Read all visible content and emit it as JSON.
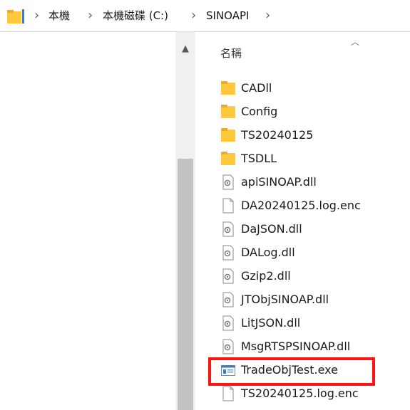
{
  "breadcrumb": {
    "items": [
      "本機",
      "本機磁碟 (C:)",
      "SINOAPI"
    ],
    "separator": "›"
  },
  "list": {
    "column_header": "名稱",
    "files": [
      {
        "name": "CADll",
        "icon": "folder-icon"
      },
      {
        "name": "Config",
        "icon": "folder-icon"
      },
      {
        "name": "TS20240125",
        "icon": "folder-icon"
      },
      {
        "name": "TSDLL",
        "icon": "folder-icon"
      },
      {
        "name": "apiSINOAP.dll",
        "icon": "dll-icon"
      },
      {
        "name": "DA20240125.log.enc",
        "icon": "file-icon"
      },
      {
        "name": "DaJSON.dll",
        "icon": "dll-icon"
      },
      {
        "name": "DALog.dll",
        "icon": "dll-icon"
      },
      {
        "name": "Gzip2.dll",
        "icon": "dll-icon"
      },
      {
        "name": "JTObjSINOAP.dll",
        "icon": "dll-icon"
      },
      {
        "name": "LitJSON.dll",
        "icon": "dll-icon"
      },
      {
        "name": "MsgRTSPSINOAP.dll",
        "icon": "dll-icon"
      },
      {
        "name": "TradeObjTest.exe",
        "icon": "exe-icon"
      },
      {
        "name": "TS20240125.log.enc",
        "icon": "file-icon"
      }
    ]
  },
  "colors": {
    "folder": "#ffc83d",
    "highlight": "#ff1212",
    "scrollbar_thumb": "#c2c2c2"
  }
}
